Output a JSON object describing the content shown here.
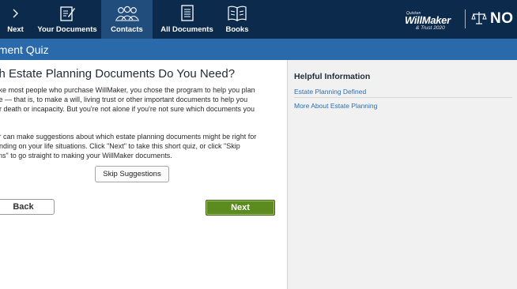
{
  "nav": {
    "items": [
      {
        "label": "Next",
        "icon": "chevron-right-icon"
      },
      {
        "label": "Your Documents",
        "icon": "document-edit-icon"
      },
      {
        "label": "Contacts",
        "icon": "contacts-icon"
      },
      {
        "label": "All Documents",
        "icon": "document-list-icon"
      },
      {
        "label": "Books",
        "icon": "book-icon"
      }
    ],
    "active": "Contacts"
  },
  "brand": {
    "quicken": "Quicken",
    "name": "WillMaker",
    "sub": "& Trust 2020",
    "nolo": "NO"
  },
  "title_bar": "ument Quiz",
  "main": {
    "heading": "ch Estate Planning Documents Do You Need?",
    "para1": [
      "re like most people who purchase WillMaker, you chose the program to help you plan",
      "state — that is, to make a will, living trust or other important documents to help you",
      "e for death or incapacity. But you're not alone if you're not sure which documents you"
    ],
    "para2": [
      "aker can make suggestions about which estate planning documents might be right for",
      "epending on your life situations. Click \"Next\" to take this short quiz, or click \"Skip",
      "stions\" to go straight to making your WillMaker documents."
    ],
    "skip_label": "Skip Suggestions",
    "back_label": "Back",
    "next_label": "Next"
  },
  "help": {
    "title": "Helpful Information",
    "links": [
      "Estate Planning Defined",
      "More About Estate Planning"
    ]
  },
  "colors": {
    "nav_bg": "#0b2a4c",
    "nav_active": "#214d7c",
    "title_bar": "#2b6aaa",
    "next_button": "#5c8c1f",
    "link": "#2b6eb0"
  }
}
